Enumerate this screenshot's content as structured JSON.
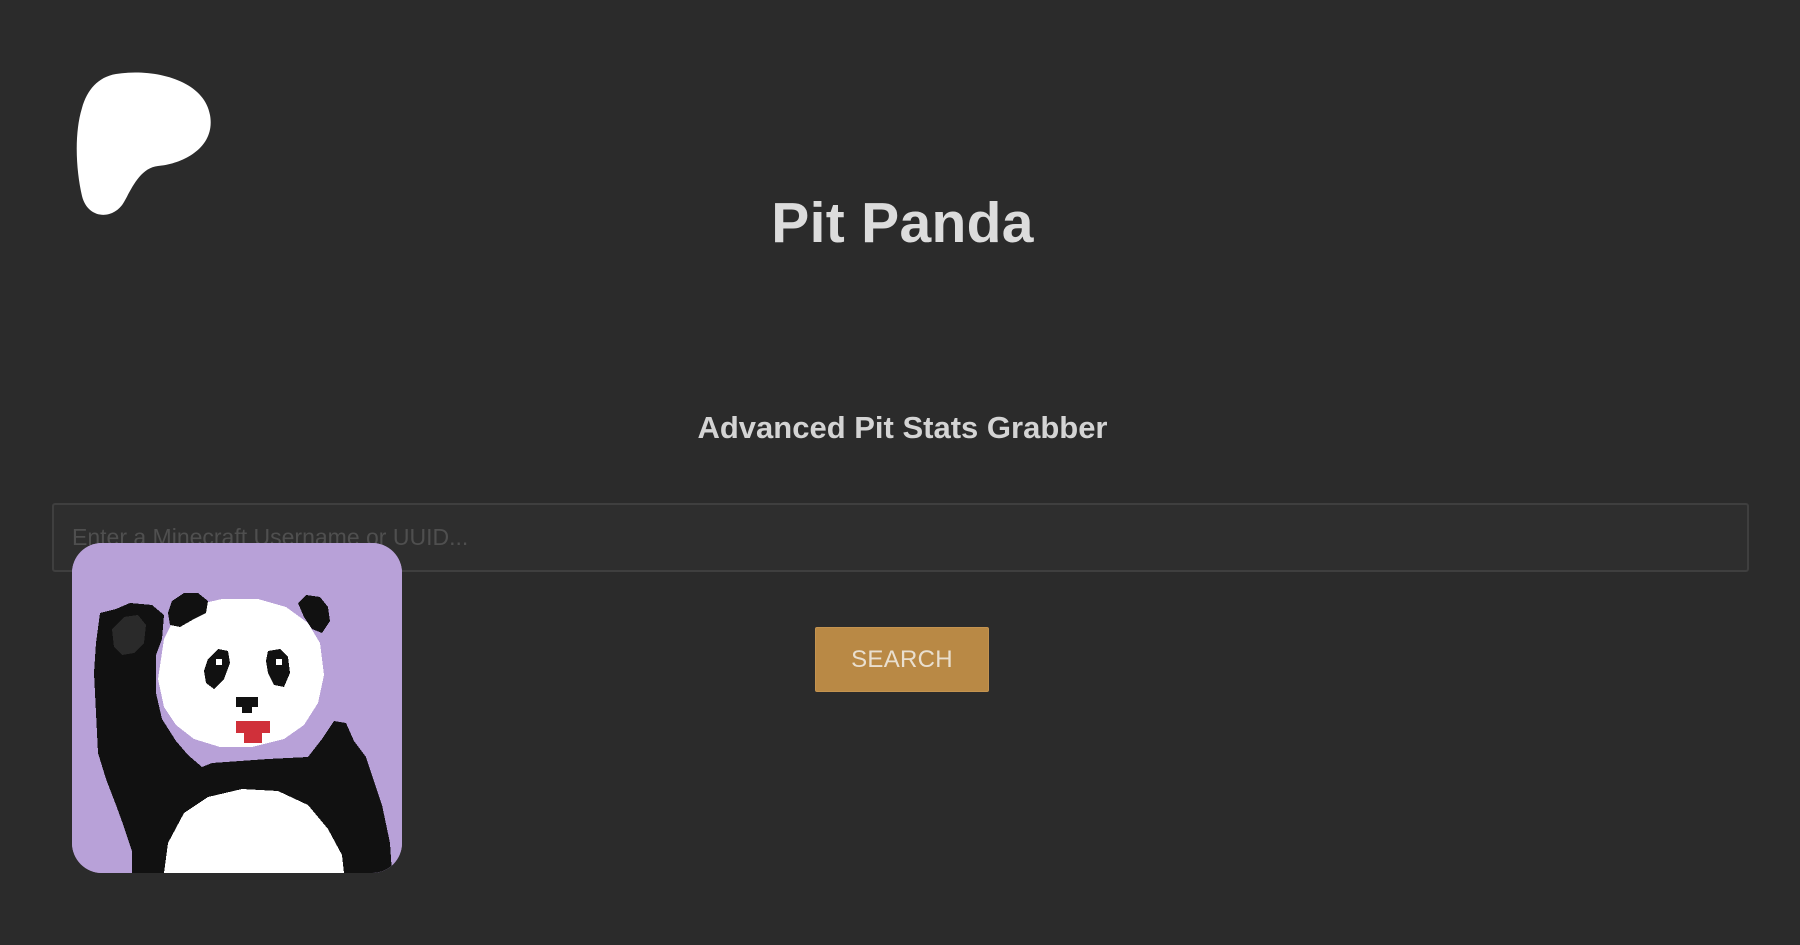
{
  "app": {
    "title": "Pit Panda",
    "subtitle": "Advanced Pit Stats Grabber"
  },
  "search": {
    "placeholder": "Enter a Minecraft Username or UUID...",
    "value": "",
    "button_label": "SEARCH"
  },
  "icons": {
    "brand": "patreon-logo-icon",
    "mascot": "pixel-panda-waving-icon"
  },
  "colors": {
    "background": "#2b2b2b",
    "accent": "#b98945",
    "mascot_background": "#b8a1d8"
  }
}
